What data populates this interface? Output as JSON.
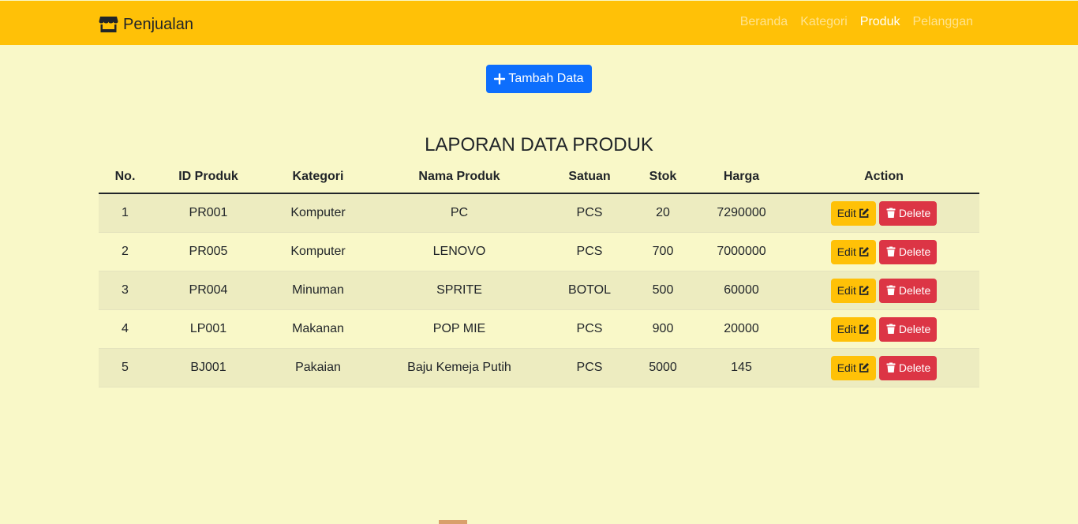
{
  "navbar": {
    "brand": "Penjualan",
    "brand_icon": "shop-icon",
    "links": [
      {
        "label": "Beranda",
        "active": false
      },
      {
        "label": "Kategori",
        "active": false
      },
      {
        "label": "Produk",
        "active": true
      },
      {
        "label": "Pelanggan",
        "active": false
      }
    ]
  },
  "toolbar": {
    "add_label": "Tambah Data",
    "add_icon": "plus-icon"
  },
  "report": {
    "title": "LAPORAN DATA PRODUK"
  },
  "table": {
    "headers": [
      "No.",
      "ID Produk",
      "Kategori",
      "Nama Produk",
      "Satuan",
      "Stok",
      "Harga",
      "Action"
    ],
    "rows": [
      {
        "no": "1",
        "id": "PR001",
        "kategori": "Komputer",
        "nama": "PC",
        "satuan": "PCS",
        "stok": "20",
        "harga": "7290000"
      },
      {
        "no": "2",
        "id": "PR005",
        "kategori": "Komputer",
        "nama": "LENOVO",
        "satuan": "PCS",
        "stok": "700",
        "harga": "7000000"
      },
      {
        "no": "3",
        "id": "PR004",
        "kategori": "Minuman",
        "nama": "SPRITE",
        "satuan": "BOTOL",
        "stok": "500",
        "harga": "60000"
      },
      {
        "no": "4",
        "id": "LP001",
        "kategori": "Makanan",
        "nama": "POP MIE",
        "satuan": "PCS",
        "stok": "900",
        "harga": "20000"
      },
      {
        "no": "5",
        "id": "BJ001",
        "kategori": "Pakaian",
        "nama": "Baju Kemeja Putih",
        "satuan": "PCS",
        "stok": "5000",
        "harga": "145"
      }
    ],
    "edit_label": "Edit",
    "delete_label": "Delete",
    "edit_icon": "pencil-square-icon",
    "delete_icon": "trash-icon"
  },
  "colors": {
    "navbar": "#ffc107",
    "page_bg": "#f9f8c8",
    "primary": "#0d6efd",
    "warning": "#ffc107",
    "danger": "#dc3545"
  }
}
